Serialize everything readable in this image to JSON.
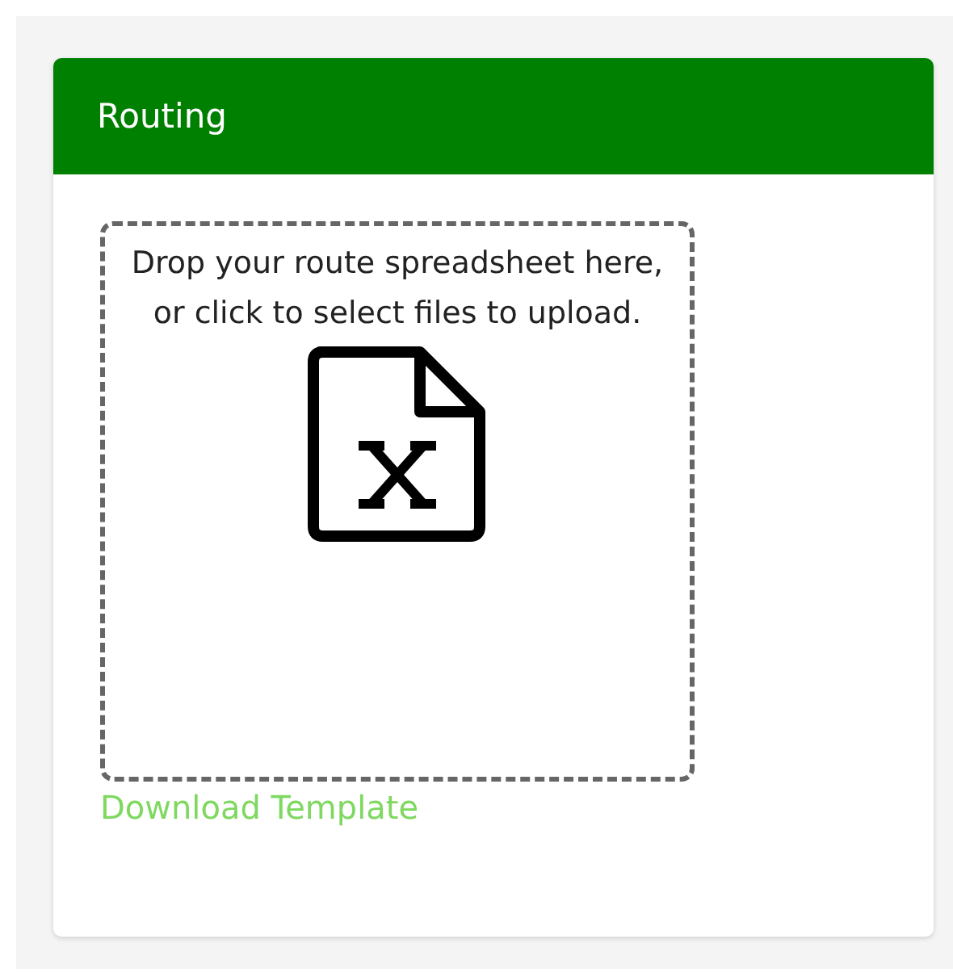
{
  "card": {
    "title": "Routing"
  },
  "dropzone": {
    "text": "Drop your route spreadsheet here, or click to select files to upload."
  },
  "link": {
    "label": "Download Template"
  }
}
